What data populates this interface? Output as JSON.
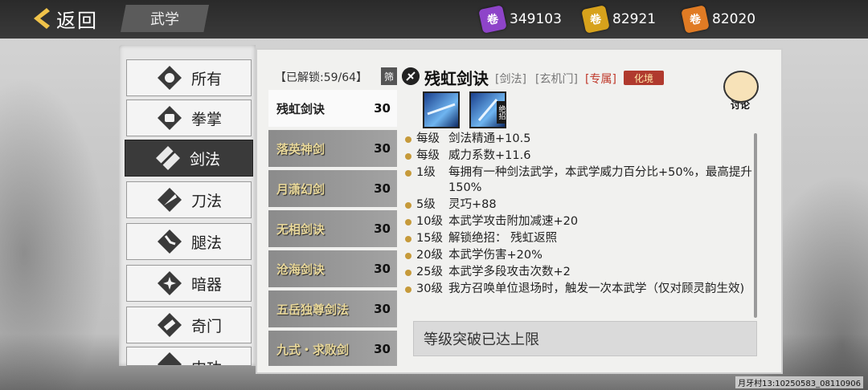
{
  "header": {
    "back_label": "返回",
    "title": "武学",
    "currencies": [
      {
        "icon": "purple-scroll-icon",
        "color": "#8e44c9",
        "value": "349103"
      },
      {
        "icon": "gold-scroll-icon",
        "color": "#d7a21c",
        "value": "82921"
      },
      {
        "icon": "orange-scroll-icon",
        "color": "#e07b24",
        "value": "82020"
      }
    ]
  },
  "categories": [
    {
      "label": "所有",
      "icon": "all-icon",
      "active": false
    },
    {
      "label": "拳掌",
      "icon": "fist-icon",
      "active": false
    },
    {
      "label": "剑法",
      "icon": "sword-icon",
      "active": true
    },
    {
      "label": "刀法",
      "icon": "blade-icon",
      "active": false
    },
    {
      "label": "腿法",
      "icon": "kick-icon",
      "active": false
    },
    {
      "label": "暗器",
      "icon": "shuriken-icon",
      "active": false
    },
    {
      "label": "奇门",
      "icon": "scroll-icon",
      "active": false
    },
    {
      "label": "内功",
      "icon": "inner-icon",
      "active": false
    }
  ],
  "list": {
    "unlocked_label": "【已解锁:59/64】",
    "filter_label": "筛",
    "skills": [
      {
        "name": "残虹剑诀",
        "level": "30",
        "active": true
      },
      {
        "name": "落英神剑",
        "level": "30",
        "active": false
      },
      {
        "name": "月潇幻剑",
        "level": "30",
        "active": false
      },
      {
        "name": "无相剑诀",
        "level": "30",
        "active": false
      },
      {
        "name": "沧海剑诀",
        "level": "30",
        "active": false
      },
      {
        "name": "五岳独尊剑法",
        "level": "30",
        "active": false
      },
      {
        "name": "九式・求败剑",
        "level": "30",
        "active": false
      }
    ]
  },
  "detail": {
    "title": "残虹剑诀",
    "tags": [
      "[剑法]",
      "[玄机门]"
    ],
    "exclusive_tag": "[专属]",
    "realm_badge": "化境",
    "discuss_label": "讨论",
    "tile_badge": "绝招",
    "effects": [
      {
        "level": "每级",
        "text": "剑法精通+10.5"
      },
      {
        "level": "每级",
        "text": "威力系数+11.6"
      },
      {
        "level": "1级",
        "text": "每拥有一种剑法武学，本武学威力百分比+50%，最高提升150%"
      },
      {
        "level": "5级",
        "text": "灵巧+88"
      },
      {
        "level": "10级",
        "text": "本武学攻击附加减速+20"
      },
      {
        "level": "15级",
        "text": "解锁绝招：  残虹返照"
      },
      {
        "level": "20级",
        "text": "本武学伤害+20%"
      },
      {
        "level": "25级",
        "text": "本武学多段攻击次数+2"
      },
      {
        "level": "30级",
        "text": "我方召唤单位退场时，触发一次本武学（仅对顾灵韵生效)"
      }
    ],
    "max_notice": "等级突破已达上限"
  },
  "footer_text": "月牙村13:10250583_08110906"
}
